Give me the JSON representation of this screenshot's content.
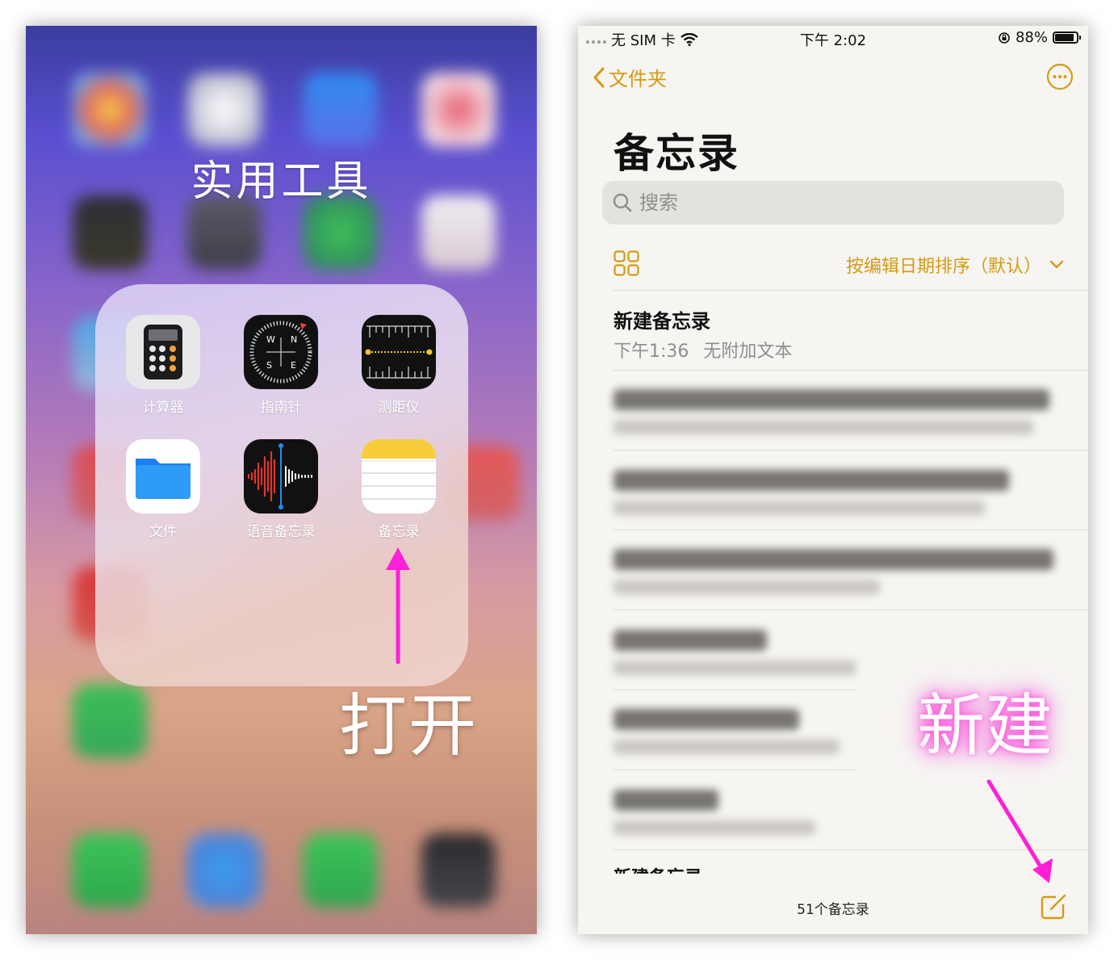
{
  "folder": {
    "title": "实用工具",
    "apps": [
      {
        "label": "计算器",
        "icon": "calculator-icon"
      },
      {
        "label": "指南针",
        "icon": "compass-icon"
      },
      {
        "label": "测距仪",
        "icon": "measure-icon"
      },
      {
        "label": "文件",
        "icon": "files-icon"
      },
      {
        "label": "语音备忘录",
        "icon": "voice-memos-icon"
      },
      {
        "label": "备忘录",
        "icon": "notes-icon"
      }
    ],
    "compass_letters": {
      "w": "W",
      "n": "N",
      "s": "S",
      "e": "E"
    }
  },
  "annotations": {
    "open": "打开",
    "new": "新建",
    "arrow_color": "#ff1fd8"
  },
  "status_bar": {
    "carrier": "无 SIM 卡",
    "time": "下午 2:02",
    "battery": "88%",
    "battery_level": 0.88
  },
  "nav": {
    "back_label": "文件夹"
  },
  "notes_app": {
    "title": "备忘录",
    "search_placeholder": "搜索",
    "sort_label": "按编辑日期排序（默认）",
    "first_note": {
      "title": "新建备忘录",
      "time": "下午1:36",
      "preview": "无附加文本"
    },
    "cutoff_note_title": "新建备忘录",
    "footer_count": "51个备忘录"
  },
  "colors": {
    "accent": "#d69a12",
    "notes_bg": "#f6f5f2"
  }
}
